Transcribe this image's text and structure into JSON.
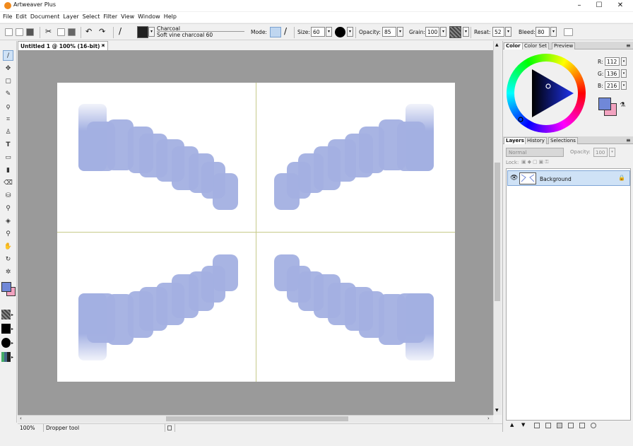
{
  "window": {
    "title": "Artweaver Plus",
    "minimize": "–",
    "maximize": "☐",
    "close": "✕"
  },
  "menu": [
    "File",
    "Edit",
    "Document",
    "Layer",
    "Select",
    "Filter",
    "View",
    "Window",
    "Help"
  ],
  "toolbar": {
    "brush_category": "Charcoal",
    "brush_variant": "Soft vine charcoal 60",
    "mode_label": "Mode:",
    "size_label": "Size:",
    "size_value": "60",
    "opacity_label": "Opacity:",
    "opacity_value": "85",
    "grain_label": "Grain:",
    "grain_value": "100",
    "resat_label": "Resat:",
    "resat_value": "52",
    "bleed_label": "Bleed:",
    "bleed_value": "80"
  },
  "document": {
    "tab_title": "Untitled 1 @ 100% (16-bit) *",
    "tab_close": "✕"
  },
  "status": {
    "zoom": "100%",
    "message": "Dropper tool"
  },
  "color_panel": {
    "tabs": [
      "Color",
      "Color Set",
      "Preview"
    ],
    "r_label": "R:",
    "r_value": "112",
    "g_label": "G:",
    "g_value": "136",
    "b_label": "B:",
    "b_value": "216",
    "foreground": "#7088d8",
    "background": "#f2a3c0"
  },
  "layers_panel": {
    "tabs": [
      "Layers",
      "History",
      "Selections"
    ],
    "blend_mode": "Normal",
    "opacity_label": "Opacity:",
    "opacity_value": "100",
    "lock_label": "Lock:",
    "layers": [
      {
        "name": "Background"
      }
    ]
  },
  "colors": {
    "stroke": "#a3b0e2",
    "guide": "#c6ca8a",
    "canvas_bg": "#9a9a9a"
  }
}
